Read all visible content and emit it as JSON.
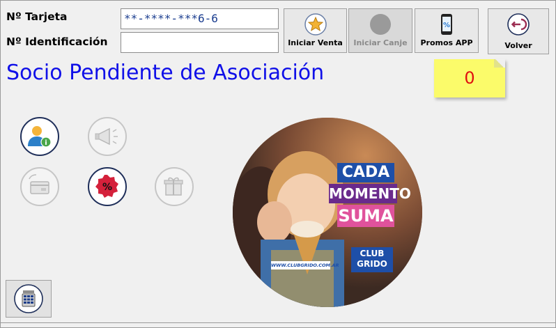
{
  "form": {
    "card_label": "Nº Tarjeta",
    "card_value": "**-****-***6-6",
    "id_label": "Nº Identificación",
    "id_value": ""
  },
  "toolbar": {
    "start_sale": "Iniciar Venta",
    "start_exchange": "Iniciar Canje",
    "promos_app": "Promos APP",
    "back": "Volver"
  },
  "status": {
    "message": "Socio Pendiente de Asociación",
    "points": "0"
  },
  "banner": {
    "line1": "CADA",
    "line2": "MOMENTO",
    "line3": "SUMA",
    "brand_line1": "CLUB",
    "brand_line2": "GRIDO",
    "website": "WWW.CLUBGRIDO.COM.AR"
  },
  "colors": {
    "title": "#1010e8",
    "note_bg": "#fbfb6a",
    "points": "#e01010",
    "banner_blue": "#1e4fa8",
    "banner_purple": "#6a2a8c",
    "banner_pink": "#e0529c"
  },
  "icons": [
    "star-icon",
    "circle-icon",
    "phone-percent-icon",
    "back-arrow-icon",
    "user-info-icon",
    "megaphone-icon",
    "card-refund-icon",
    "percent-badge-icon",
    "gift-icon",
    "keypad-icon"
  ]
}
